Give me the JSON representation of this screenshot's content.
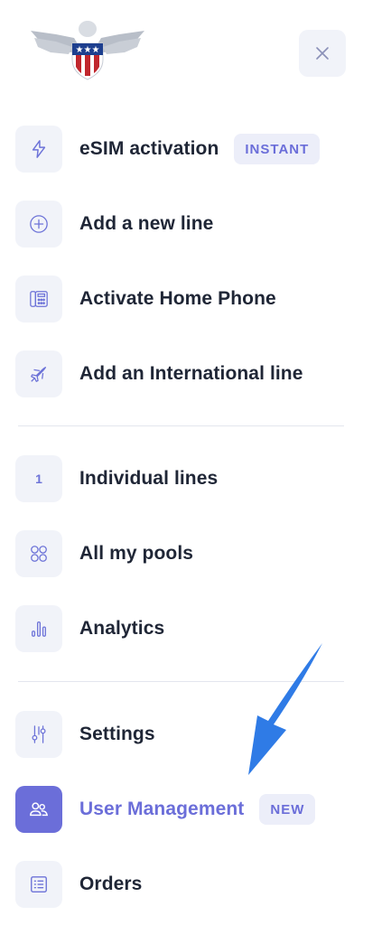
{
  "header": {
    "logo_icon": "eagle-shield-logo",
    "close_icon": "close-icon"
  },
  "menu": {
    "group1": [
      {
        "label": "eSIM activation",
        "icon": "lightning-icon",
        "badge": "INSTANT"
      },
      {
        "label": "Add a new line",
        "icon": "plus-circle-icon"
      },
      {
        "label": "Activate Home Phone",
        "icon": "home-phone-icon"
      },
      {
        "label": "Add an International line",
        "icon": "airplane-icon"
      }
    ],
    "group2": [
      {
        "label": "Individual lines",
        "icon_text": "1"
      },
      {
        "label": "All my pools",
        "icon": "pools-icon"
      },
      {
        "label": "Analytics",
        "icon": "bar-chart-icon"
      }
    ],
    "group3": [
      {
        "label": "Settings",
        "icon": "sliders-icon"
      },
      {
        "label": "User Management",
        "icon": "users-icon",
        "badge": "NEW",
        "active": true
      },
      {
        "label": "Orders",
        "icon": "list-icon"
      }
    ]
  },
  "annotation": {
    "arrow_icon": "pointer-arrow-icon",
    "color": "#2f7be6"
  },
  "colors": {
    "accent": "#6b6ed9",
    "icon_bg": "#f1f3f9",
    "text": "#1f2636"
  }
}
